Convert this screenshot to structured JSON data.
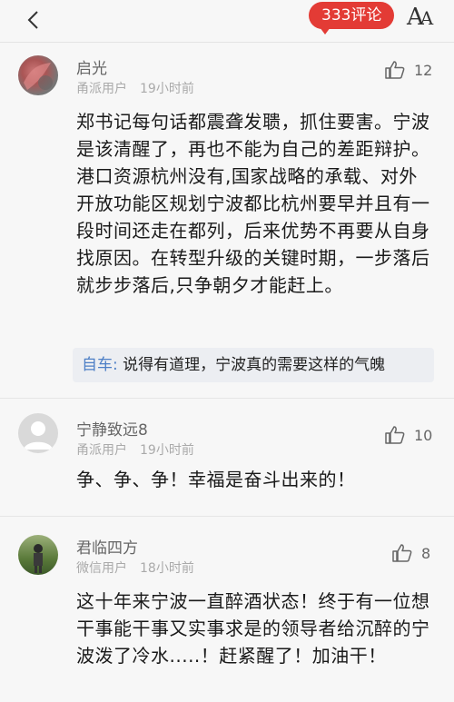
{
  "topbar": {
    "comment_count_label": "333评论",
    "font_button_big": "A",
    "font_button_small": "A"
  },
  "comments": [
    {
      "username": "启光",
      "source": "甬派用户",
      "time": "19小时前",
      "likes": "12",
      "body": "郑书记每句话都震聋发聩，抓住要害。宁波是该清醒了，再也不能为自己的差距辩护。港口资源杭州没有,国家战略的承载、对外开放功能区规划宁波都比杭州要早并且有一段时间还走在都列，后来优势不再要从自身找原因。在转型升级的关键时期，一步落后就步步落后,只争朝夕才能赶上。",
      "reply": {
        "author": "自车:",
        "text": "说得有道理，宁波真的需要这样的气魄"
      }
    },
    {
      "username": "宁静致远8",
      "source": "甬派用户",
      "time": "19小时前",
      "likes": "10",
      "body": "争、争、争！幸福是奋斗出来的！"
    },
    {
      "username": "君临四方",
      "source": "微信用户",
      "time": "18小时前",
      "likes": "8",
      "body": "这十年来宁波一直醉酒状态！终于有一位想干事能干事又实事求是的领导者给沉醉的宁波泼了冷水.....！赶紧醒了！加油干！"
    }
  ],
  "colors": {
    "accent": "#e33b35",
    "reply_author": "#4d7fc6",
    "meta": "#aaaaaa"
  }
}
